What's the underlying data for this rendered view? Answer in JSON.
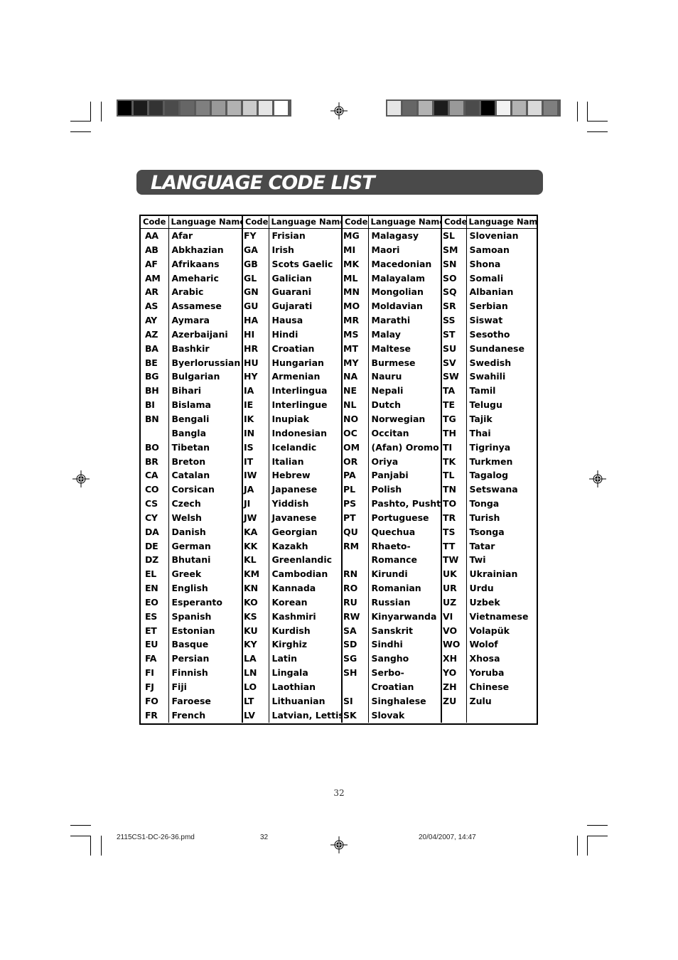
{
  "page": {
    "title": "LANGUAGE CODE LIST",
    "page_number": "32",
    "footer": {
      "filename": "2115CS1-DC-26-36.pmd",
      "page": "32",
      "datetime": "20/04/2007, 14:47"
    }
  },
  "colorbars": {
    "left": [
      "#000000",
      "#1c1c1c",
      "#333333",
      "#4b4b4b",
      "#666666",
      "#7f7f7f",
      "#999999",
      "#b2b2b2",
      "#cccccc",
      "#e5e5e5",
      "#ffffff"
    ],
    "right": [
      "#e5e5e5",
      "#666666",
      "#b2b2b2",
      "#1c1c1c",
      "#999999",
      "#4b4b4b",
      "#000000",
      "#f2f2f2",
      "#b2b2b2",
      "#d9d9d9",
      "#7f7f7f"
    ]
  },
  "table": {
    "headers": [
      "Code",
      "Language Name",
      "Code",
      "Language Name",
      "Code",
      "Language Name",
      "Code",
      "Language Name"
    ],
    "rows": [
      [
        "AA",
        "Afar",
        "FY",
        "Frisian",
        "MG",
        "Malagasy",
        "SL",
        "Slovenian"
      ],
      [
        "AB",
        "Abkhazian",
        "GA",
        "Irish",
        "MI",
        "Maori",
        "SM",
        "Samoan"
      ],
      [
        "AF",
        "Afrikaans",
        "GB",
        "Scots Gaelic",
        "MK",
        "Macedonian",
        "SN",
        "Shona"
      ],
      [
        "AM",
        "Ameharic",
        "GL",
        "Galician",
        "ML",
        "Malayalam",
        "SO",
        "Somali"
      ],
      [
        "AR",
        "Arabic",
        "GN",
        "Guarani",
        "MN",
        "Mongolian",
        "SQ",
        "Albanian"
      ],
      [
        "AS",
        "Assamese",
        "GU",
        "Gujarati",
        "MO",
        "Moldavian",
        "SR",
        "Serbian"
      ],
      [
        "AY",
        "Aymara",
        "HA",
        "Hausa",
        "MR",
        "Marathi",
        "SS",
        "Siswat"
      ],
      [
        "AZ",
        "Azerbaijani",
        "HI",
        "Hindi",
        "MS",
        "Malay",
        "ST",
        "Sesotho"
      ],
      [
        "BA",
        "Bashkir",
        "HR",
        "Croatian",
        "MT",
        "Maltese",
        "SU",
        "Sundanese"
      ],
      [
        "BE",
        "Byerlorussian",
        "HU",
        "Hungarian",
        "MY",
        "Burmese",
        "SV",
        "Swedish"
      ],
      [
        "BG",
        "Bulgarian",
        "HY",
        "Armenian",
        "NA",
        "Nauru",
        "SW",
        "Swahili"
      ],
      [
        "BH",
        "Bihari",
        "IA",
        "Interlingua",
        "NE",
        "Nepali",
        "TA",
        "Tamil"
      ],
      [
        "BI",
        "Bislama",
        "IE",
        "Interlingue",
        "NL",
        "Dutch",
        "TE",
        "Telugu"
      ],
      [
        "BN",
        "Bengali",
        "IK",
        "Inupiak",
        "NO",
        "Norwegian",
        "TG",
        "Tajik"
      ],
      [
        "",
        "Bangla",
        "IN",
        "Indonesian",
        "OC",
        "Occitan",
        "TH",
        "Thai"
      ],
      [
        "BO",
        "Tibetan",
        "IS",
        "Icelandic",
        "OM",
        "(Afan) Oromo",
        "TI",
        "Tigrinya"
      ],
      [
        "BR",
        "Breton",
        "IT",
        "Italian",
        "OR",
        "Oriya",
        "TK",
        "Turkmen"
      ],
      [
        "CA",
        "Catalan",
        "IW",
        "Hebrew",
        "PA",
        "Panjabi",
        "TL",
        "Tagalog"
      ],
      [
        "CO",
        "Corsican",
        "JA",
        "Japanese",
        "PL",
        "Polish",
        "TN",
        "Setswana"
      ],
      [
        "CS",
        "Czech",
        "JI",
        "Yiddish",
        "PS",
        "Pashto, Pushto",
        "TO",
        "Tonga"
      ],
      [
        "CY",
        "Welsh",
        "JW",
        "Javanese",
        "PT",
        "Portuguese",
        "TR",
        "Turish"
      ],
      [
        "DA",
        "Danish",
        "KA",
        "Georgian",
        "QU",
        "Quechua",
        "TS",
        "Tsonga"
      ],
      [
        "DE",
        "German",
        "KK",
        "Kazakh",
        "RM",
        "Rhaeto-",
        "TT",
        "Tatar"
      ],
      [
        "DZ",
        "Bhutani",
        "KL",
        "Greenlandic",
        "",
        "Romance",
        "TW",
        "Twi"
      ],
      [
        "EL",
        "Greek",
        "KM",
        "Cambodian",
        "RN",
        "Kirundi",
        "UK",
        "Ukrainian"
      ],
      [
        "EN",
        "English",
        "KN",
        "Kannada",
        "RO",
        "Romanian",
        "UR",
        "Urdu"
      ],
      [
        "EO",
        "Esperanto",
        "KO",
        "Korean",
        "RU",
        "Russian",
        "UZ",
        "Uzbek"
      ],
      [
        "ES",
        "Spanish",
        "KS",
        "Kashmiri",
        "RW",
        "Kinyarwanda",
        "VI",
        "Vietnamese"
      ],
      [
        "ET",
        "Estonian",
        "KU",
        "Kurdish",
        "SA",
        "Sanskrit",
        "VO",
        "Volapük"
      ],
      [
        "EU",
        "Basque",
        "KY",
        "Kirghiz",
        "SD",
        "Sindhi",
        "WO",
        "Wolof"
      ],
      [
        "FA",
        "Persian",
        "LA",
        "Latin",
        "SG",
        "Sangho",
        "XH",
        "Xhosa"
      ],
      [
        "FI",
        "Finnish",
        "LN",
        "Lingala",
        "SH",
        "Serbo-",
        "YO",
        "Yoruba"
      ],
      [
        "FJ",
        "Fiji",
        "LO",
        "Laothian",
        "",
        "Croatian",
        "ZH",
        "Chinese"
      ],
      [
        "FO",
        "Faroese",
        "LT",
        "Lithuanian",
        "SI",
        "Singhalese",
        "ZU",
        "Zulu"
      ],
      [
        "FR",
        "French",
        "LV",
        "Latvian, Lettish",
        "SK",
        "Slovak",
        "",
        ""
      ]
    ]
  }
}
